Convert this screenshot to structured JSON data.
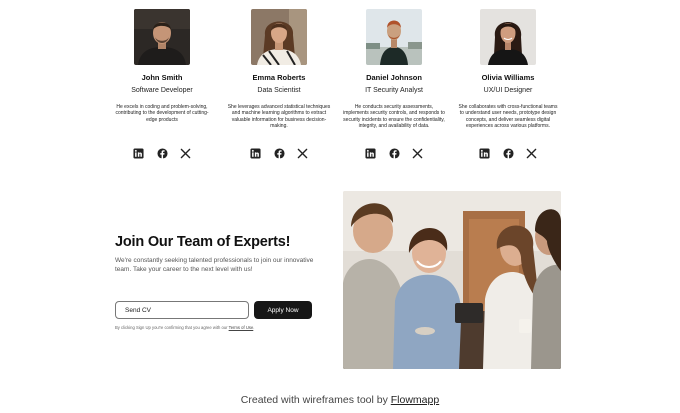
{
  "team": {
    "members": [
      {
        "name": "John Smith",
        "role": "Software Developer",
        "bio": "He excels in coding and problem-solving, contributing to the development of cutting-edge products"
      },
      {
        "name": "Emma Roberts",
        "role": "Data Scientist",
        "bio": "She leverages advanced statistical techniques and machine learning algorithms to extract valuable information for business decision-making."
      },
      {
        "name": "Daniel Johnson",
        "role": "IT Security Analyst",
        "bio": "He conducts security assessments, implements security controls, and responds to security incidents to ensure the confidentiality, integrity, and availability of data."
      },
      {
        "name": "Olivia Williams",
        "role": "UX/UI Designer",
        "bio": "She collaborates with cross-functional teams to understand user needs, prototype design concepts, and deliver seamless digital experiences across various platforms."
      }
    ],
    "social_icons": [
      "linkedin-icon",
      "facebook-icon",
      "x-icon"
    ]
  },
  "cta": {
    "title": "Join Our Team of Experts!",
    "description": "We're constantly seeking talented professionals to join our innovative team. Take your career to the next level with us!",
    "input_value": "Send CV",
    "button_label": "Apply Now",
    "consent_text": "By clicking Sign Up you're confirming that you agree with our ",
    "consent_link": "Terms of Use",
    "consent_end": "."
  },
  "footer": {
    "text": "Created with wireframes tool by ",
    "link": "Flowmapp"
  },
  "colors": {
    "button_bg": "#161616",
    "text_primary": "#111111",
    "text_muted": "#555555"
  }
}
